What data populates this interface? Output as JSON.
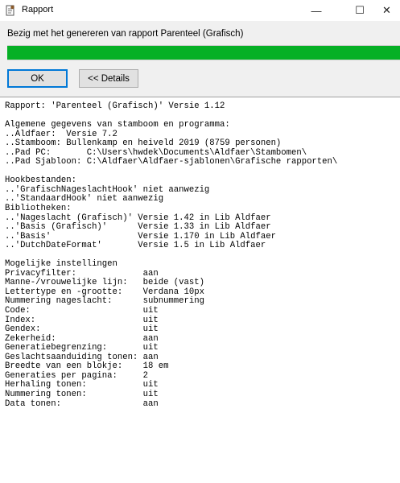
{
  "window": {
    "title": "Rapport",
    "minimize_glyph": "—",
    "maximize_glyph": "☐",
    "close_glyph": "✕"
  },
  "status": {
    "text": "Bezig met het genereren van rapport Parenteel (Grafisch)",
    "progress": 1.0,
    "progress_color": "#06b025"
  },
  "buttons": {
    "ok_label": "OK",
    "details_label": "<< Details"
  },
  "log": {
    "lines": [
      "Rapport: 'Parenteel (Grafisch)' Versie 1.12",
      "",
      "Algemene gegevens van stamboom en programma:",
      "..Aldfaer:  Versie 7.2",
      "..Stamboom: Bullenkamp en heiveld 2019 (8759 personen)",
      "..Pad PC:       C:\\Users\\hwdek\\Documents\\Aldfaer\\Stambomen\\",
      "..Pad Sjabloon: C:\\Aldfaer\\Aldfaer-sjablonen\\Grafische rapporten\\",
      "",
      "Hookbestanden:",
      "..'GrafischNageslachtHook' niet aanwezig",
      "..'StandaardHook' niet aanwezig",
      "Bibliotheken:",
      "..'Nageslacht (Grafisch)' Versie 1.42 in Lib Aldfaer",
      "..'Basis (Grafisch)'      Versie 1.33 in Lib Aldfaer",
      "..'Basis'                 Versie 1.170 in Lib Aldfaer",
      "..'DutchDateFormat'       Versie 1.5 in Lib Aldfaer",
      "",
      "Mogelijke instellingen",
      "Privacyfilter:             aan",
      "Manne-/vrouwelijke lijn:   beide (vast)",
      "Lettertype en -grootte:    Verdana 10px",
      "Nummering nageslacht:      subnummering",
      "Code:                      uit",
      "Index:                     uit",
      "Gendex:                    uit",
      "Zekerheid:                 aan",
      "Generatiebegrenzing:       uit",
      "Geslachtsaanduiding tonen: aan",
      "Breedte van een blokje:    18 em",
      "Generaties per pagina:     2",
      "Herhaling tonen:           uit",
      "Nummering tonen:           uit",
      "Data tonen:                aan"
    ]
  }
}
